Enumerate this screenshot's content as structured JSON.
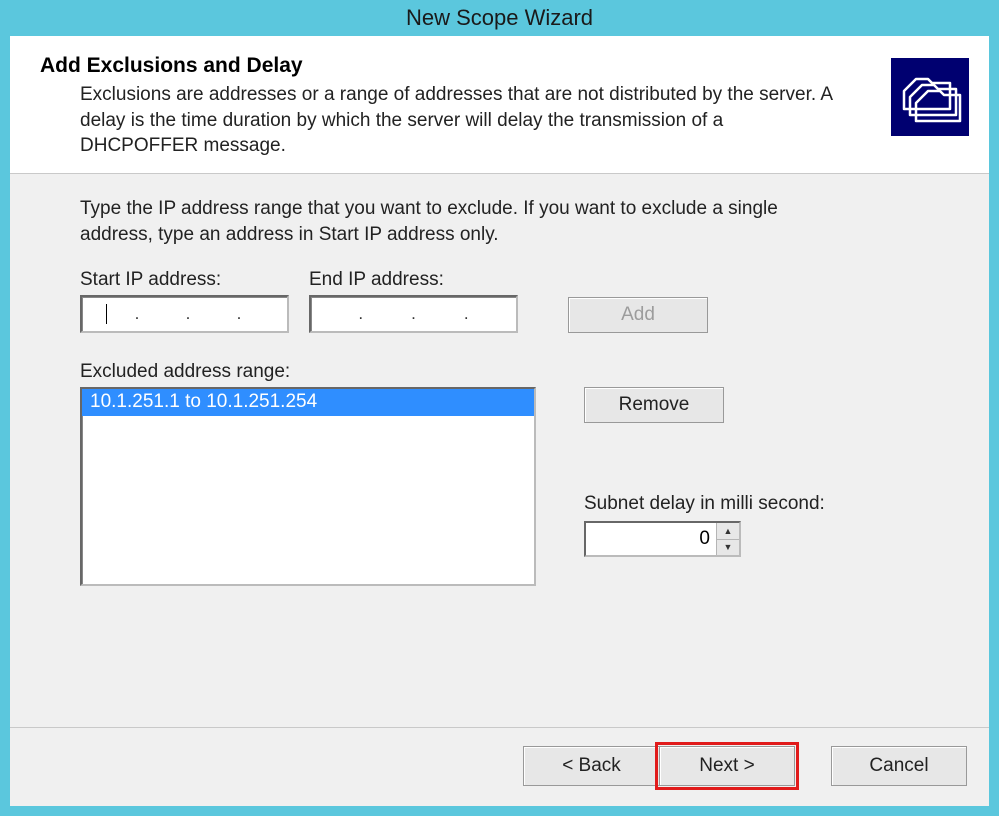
{
  "window": {
    "title": "New Scope Wizard"
  },
  "header": {
    "title": "Add Exclusions and Delay",
    "description": "Exclusions are addresses or a range of addresses that are not distributed by the server. A delay is the time duration by which the server will delay the transmission of a DHCPOFFER message.",
    "icon_name": "folders-icon"
  },
  "body": {
    "intro": "Type the IP address range that you want to exclude. If you want to exclude a single address, type an address in Start IP address only.",
    "start_ip_label": "Start IP address:",
    "end_ip_label": "End IP address:",
    "start_ip_value": "",
    "end_ip_value": "",
    "add_button": "Add",
    "excluded_label": "Excluded address range:",
    "excluded_items": [
      "10.1.251.1 to 10.1.251.254"
    ],
    "remove_button": "Remove",
    "delay_label": "Subnet delay in milli second:",
    "delay_value": "0"
  },
  "footer": {
    "back": "< Back",
    "next": "Next >",
    "cancel": "Cancel"
  }
}
